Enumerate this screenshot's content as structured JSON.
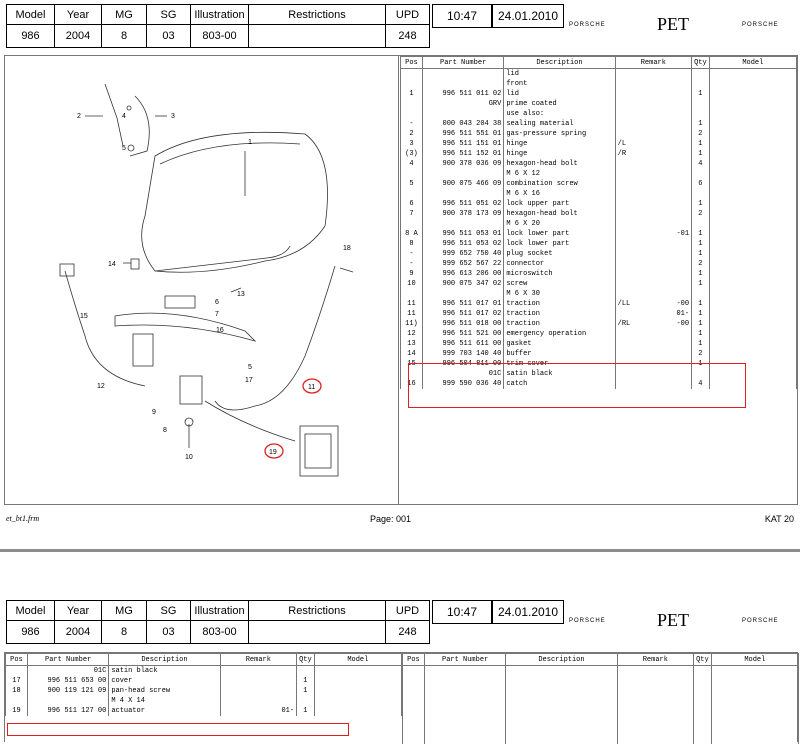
{
  "header": {
    "labels": [
      "Model",
      "Year",
      "MG",
      "SG",
      "Illustration",
      "Restrictions",
      "UPD"
    ],
    "values": [
      "986",
      "2004",
      "8",
      "03",
      "803-00",
      "",
      "248"
    ],
    "time": "10:47",
    "date": "24.01.2010",
    "logo_left": "PORSCHE",
    "pet": "PET",
    "logo_right": "PORSCHE"
  },
  "columns": [
    "Pos",
    "Part Number",
    "Description",
    "Remark",
    "Qty",
    "Model"
  ],
  "parts_page1": [
    {
      "pos": "",
      "pn": "",
      "desc": "lid",
      "rem": "",
      "rem2": "",
      "qty": ""
    },
    {
      "pos": "",
      "pn": "",
      "desc": "front",
      "rem": "",
      "rem2": "",
      "qty": ""
    },
    {
      "pos": "1",
      "pn": "996 511 011 02",
      "desc": "lid",
      "rem": "",
      "rem2": "",
      "qty": "1"
    },
    {
      "pos": "",
      "pn": "GRV",
      "desc": "prime coated",
      "rem": "",
      "rem2": "",
      "qty": ""
    },
    {
      "pos": "",
      "pn": "",
      "desc": "use also:",
      "rem": "",
      "rem2": "",
      "qty": ""
    },
    {
      "pos": "-",
      "pn": "000 043 204 38",
      "desc": "sealing material",
      "rem": "",
      "rem2": "",
      "qty": "1"
    },
    {
      "pos": "2",
      "pn": "996 511 551 01",
      "desc": "gas-pressure spring",
      "rem": "",
      "rem2": "",
      "qty": "2"
    },
    {
      "pos": "3",
      "pn": "996 511 151 01",
      "desc": "hinge",
      "rem": "/L",
      "rem2": "",
      "qty": "1"
    },
    {
      "pos": "(3)",
      "pn": "996 511 152 01",
      "desc": "hinge",
      "rem": "/R",
      "rem2": "",
      "qty": "1"
    },
    {
      "pos": "4",
      "pn": "900 378 036 09",
      "desc": "hexagon-head bolt",
      "rem": "",
      "rem2": "",
      "qty": "4"
    },
    {
      "pos": "",
      "pn": "",
      "desc": "M 6 X 12",
      "rem": "",
      "rem2": "",
      "qty": ""
    },
    {
      "pos": "5",
      "pn": "900 075 466 09",
      "desc": "combination screw",
      "rem": "",
      "rem2": "",
      "qty": "6"
    },
    {
      "pos": "",
      "pn": "",
      "desc": "M 6 X 16",
      "rem": "",
      "rem2": "",
      "qty": ""
    },
    {
      "pos": "6",
      "pn": "996 511 051 02",
      "desc": "lock upper part",
      "rem": "",
      "rem2": "",
      "qty": "1"
    },
    {
      "pos": "7",
      "pn": "900 378 173 09",
      "desc": "hexagon-head bolt",
      "rem": "",
      "rem2": "",
      "qty": "2"
    },
    {
      "pos": "",
      "pn": "",
      "desc": "M 6 X 20",
      "rem": "",
      "rem2": "",
      "qty": ""
    },
    {
      "pos": "8 A",
      "pn": "996 511 053 01",
      "desc": "lock lower part",
      "rem": "",
      "rem2": "-01",
      "qty": "1"
    },
    {
      "pos": "8",
      "pn": "996 511 053 02",
      "desc": "lock lower part",
      "rem": "",
      "rem2": "",
      "qty": "1"
    },
    {
      "pos": "-",
      "pn": "999 652 750 40",
      "desc": "plug socket",
      "rem": "",
      "rem2": "",
      "qty": "1"
    },
    {
      "pos": "-",
      "pn": "999 652 567 22",
      "desc": "connector",
      "rem": "",
      "rem2": "",
      "qty": "2"
    },
    {
      "pos": "9",
      "pn": "996 613 206 00",
      "desc": "microswitch",
      "rem": "",
      "rem2": "",
      "qty": "1"
    },
    {
      "pos": "10",
      "pn": "900 075 347 02",
      "desc": "screw",
      "rem": "",
      "rem2": "",
      "qty": "1"
    },
    {
      "pos": "",
      "pn": "",
      "desc": "M 6 X 30",
      "rem": "",
      "rem2": "",
      "qty": ""
    },
    {
      "pos": "11",
      "pn": "996 511 017 01",
      "desc": "traction",
      "rem": "/LL",
      "rem2": "-00",
      "qty": "1"
    },
    {
      "pos": "11",
      "pn": "996 511 017 02",
      "desc": "traction",
      "rem": "",
      "rem2": "01-",
      "qty": "1"
    },
    {
      "pos": "11)",
      "pn": "996 511 018 00",
      "desc": "traction",
      "rem": "/RL",
      "rem2": "-00",
      "qty": "1"
    },
    {
      "pos": "12",
      "pn": "996 511 521 00",
      "desc": "emergency operation",
      "rem": "",
      "rem2": "",
      "qty": "1"
    },
    {
      "pos": "13",
      "pn": "996 511 611 00",
      "desc": "gasket",
      "rem": "",
      "rem2": "",
      "qty": "1"
    },
    {
      "pos": "14",
      "pn": "999 703 140 40",
      "desc": "buffer",
      "rem": "",
      "rem2": "",
      "qty": "2"
    },
    {
      "pos": "15",
      "pn": "996 504 811 00",
      "desc": "trim cover",
      "rem": "",
      "rem2": "",
      "qty": "1"
    },
    {
      "pos": "",
      "pn": "01C",
      "desc": "satin black",
      "rem": "",
      "rem2": "",
      "qty": ""
    },
    {
      "pos": "16",
      "pn": "999 590 036 40",
      "desc": "catch",
      "rem": "",
      "rem2": "",
      "qty": "4"
    }
  ],
  "parts_page2": [
    {
      "pos": "",
      "pn": "01C",
      "desc": "satin black",
      "rem": "",
      "rem2": "",
      "qty": ""
    },
    {
      "pos": "17",
      "pn": "996 511 653 00",
      "desc": "cover",
      "rem": "",
      "rem2": "",
      "qty": "1"
    },
    {
      "pos": "18",
      "pn": "900 119 121 09",
      "desc": "pan-head screw",
      "rem": "",
      "rem2": "",
      "qty": "1"
    },
    {
      "pos": "",
      "pn": "",
      "desc": "M 4 X 14",
      "rem": "",
      "rem2": "",
      "qty": ""
    },
    {
      "pos": "19",
      "pn": "996 511 127 00",
      "desc": "actuator",
      "rem": "",
      "rem2": "01-",
      "qty": "1"
    }
  ],
  "illustration_callouts": [
    "1",
    "2",
    "3",
    "4",
    "5",
    "5",
    "6",
    "7",
    "8",
    "9",
    "10",
    "11",
    "12",
    "13",
    "14",
    "15",
    "16",
    "17",
    "18",
    "19"
  ],
  "footer": {
    "left": "et_bt1.frm",
    "center": "Page: 001",
    "right": "KAT 20"
  },
  "colors": {
    "highlight": "#e02020",
    "frame": "#777777",
    "separator": "#8c8c8c"
  }
}
